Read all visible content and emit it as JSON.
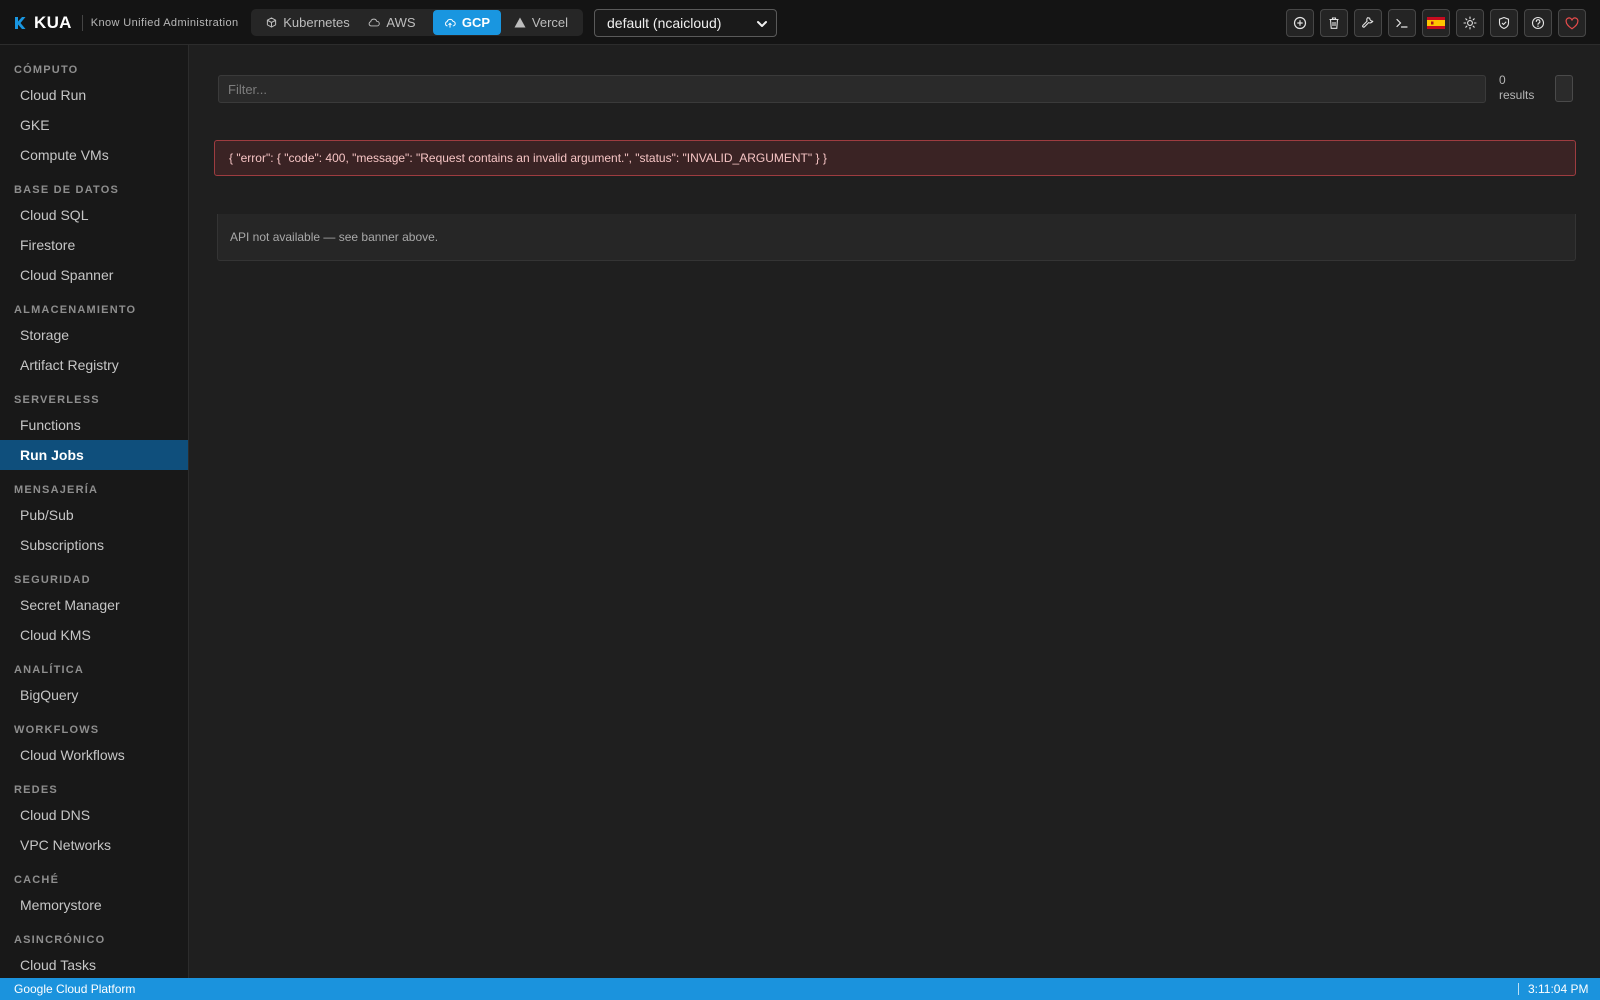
{
  "app": {
    "name": "KUA",
    "tagline": "Know Unified Administration",
    "logo_icon": "k-logo-icon",
    "accent": "#1996e0"
  },
  "providers": [
    {
      "label": "Kubernetes",
      "icon": "cube-icon",
      "active": false
    },
    {
      "label": "AWS",
      "icon": "cloud-icon",
      "active": false
    },
    {
      "label": "GCP",
      "icon": "cloud-upload-icon",
      "active": true
    },
    {
      "label": "Vercel",
      "icon": "triangle-icon",
      "active": false
    }
  ],
  "profile": {
    "selected": "default (ncaicloud)"
  },
  "toolbar": [
    {
      "icon": "add-icon"
    },
    {
      "icon": "trash-icon"
    },
    {
      "icon": "wrench-icon"
    },
    {
      "icon": "terminal-icon"
    },
    {
      "icon": "spain-flag-icon"
    },
    {
      "icon": "sun-icon"
    },
    {
      "icon": "shield-icon"
    },
    {
      "icon": "help-icon"
    },
    {
      "icon": "heart-icon",
      "color": "#e54b4b"
    }
  ],
  "sidebar": {
    "sections": [
      {
        "title": "CÓMPUTO",
        "items": [
          "Cloud Run",
          "GKE",
          "Compute VMs"
        ]
      },
      {
        "title": "BASE DE DATOS",
        "items": [
          "Cloud SQL",
          "Firestore",
          "Cloud Spanner"
        ]
      },
      {
        "title": "ALMACENAMIENTO",
        "items": [
          "Storage",
          "Artifact Registry"
        ]
      },
      {
        "title": "SERVERLESS",
        "items": [
          "Functions",
          "Run Jobs"
        ]
      },
      {
        "title": "MENSAJERÍA",
        "items": [
          "Pub/Sub",
          "Subscriptions"
        ]
      },
      {
        "title": "SEGURIDAD",
        "items": [
          "Secret Manager",
          "Cloud KMS"
        ]
      },
      {
        "title": "ANALÍTICA",
        "items": [
          "BigQuery"
        ]
      },
      {
        "title": "WORKFLOWS",
        "items": [
          "Cloud Workflows"
        ]
      },
      {
        "title": "REDES",
        "items": [
          "Cloud DNS",
          "VPC Networks"
        ]
      },
      {
        "title": "CACHÉ",
        "items": [
          "Memorystore"
        ]
      },
      {
        "title": "ASINCRÓNICO",
        "items": [
          "Cloud Tasks"
        ]
      }
    ],
    "active_item": "Run Jobs"
  },
  "main": {
    "filter": {
      "placeholder": "Filter...",
      "value": ""
    },
    "results_count": "0",
    "results_label": "results",
    "error_message": "{ \"error\": { \"code\": 400, \"message\": \"Request contains an invalid argument.\", \"status\": \"INVALID_ARGUMENT\" } }",
    "empty_message": "API not available — see banner above."
  },
  "statusbar": {
    "left": "Google Cloud Platform",
    "time": "3:11:04 PM"
  }
}
